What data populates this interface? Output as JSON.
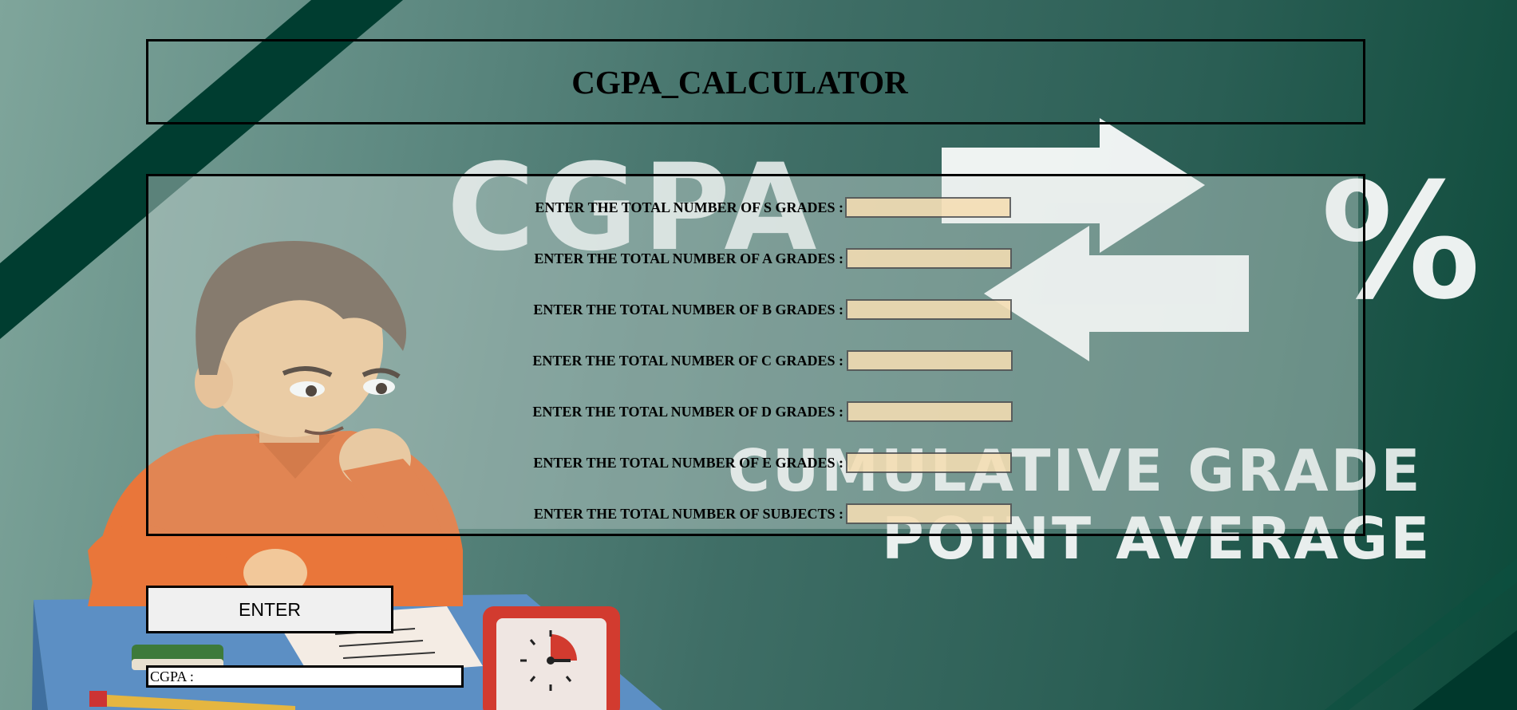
{
  "app": {
    "title": "CGPA_CALCULATOR"
  },
  "background": {
    "headline": "CGPA",
    "percent_symbol": "%",
    "subtitle_line1": "CUMULATIVE GRADE",
    "subtitle_line2": "POINT AVERAGE"
  },
  "form": {
    "fields": [
      {
        "label": "ENTER THE TOTAL NUMBER OF S GRADES :",
        "value": ""
      },
      {
        "label": "ENTER THE TOTAL NUMBER OF A GRADES :",
        "value": ""
      },
      {
        "label": "ENTER THE TOTAL NUMBER OF B GRADES :",
        "value": ""
      },
      {
        "label": "ENTER THE TOTAL NUMBER OF C GRADES :",
        "value": ""
      },
      {
        "label": "ENTER THE TOTAL NUMBER OF D GRADES :",
        "value": ""
      },
      {
        "label": "ENTER THE TOTAL NUMBER OF E GRADES :",
        "value": ""
      },
      {
        "label": "ENTER THE TOTAL NUMBER OF SUBJECTS :",
        "value": ""
      }
    ]
  },
  "actions": {
    "enter_label": "ENTER"
  },
  "result": {
    "label": "CGPA :",
    "value": ""
  },
  "colors": {
    "input_bg": "#f5deb3",
    "bg_dark": "#0c4a3a",
    "bg_light": "#7fa59b"
  }
}
